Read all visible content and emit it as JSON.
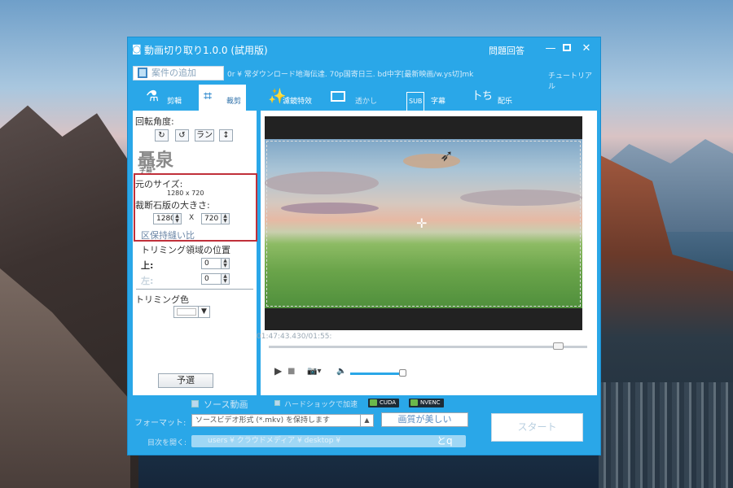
{
  "window": {
    "title": "動画切り取り1.0.0 (試用版)",
    "help": "問題回答",
    "minimize": "—",
    "close": "✕"
  },
  "filebar": {
    "add_label": "案件の追加",
    "file_path": "0r ¥ 常ダウンロード地海伝達. 70p国寄日三. bd中字[最新映画/w.ys切]mk",
    "tutorial": "チュートリアル"
  },
  "tabs": [
    {
      "label": "剪輯",
      "icon": "⚗"
    },
    {
      "label": "裁剪",
      "icon": "⌗"
    },
    {
      "label": "濾鏡特效",
      "icon": "✨"
    },
    {
      "label": "透かし",
      "icon": "▭"
    },
    {
      "label": "字幕",
      "icon": "SUB"
    },
    {
      "label": "配乐",
      "icon": "卜ち"
    }
  ],
  "left": {
    "rotation_label": "回転角度:",
    "rot_buttons": [
      "↻",
      "↺",
      "ラン",
      "↕"
    ],
    "logo_text": "聶泉",
    "logo_sub": "字幕*",
    "orig_size_label": "元のサイズ:",
    "orig_size_value": "1280 x 720",
    "crop_size_label": "裁断石版の大きさ:",
    "crop_width": "1280",
    "crop_height": "720",
    "times": "X",
    "keep_ratio": "区保持縫い比",
    "trim_pos_label": "トリミング領域の位置",
    "top_label": "上:",
    "top_value": "0",
    "left_label": "左:",
    "left_value": "0",
    "trim_color_label": "トリミング色",
    "preset_label": "予選"
  },
  "player": {
    "time": "01:47:43.430/01:55:",
    "play": "▶",
    "stop": "■",
    "camera": "📷▾",
    "volume": "🔈",
    "seek_position_pct": 93,
    "volume_pct": 95
  },
  "bottom": {
    "source_video": "ソース動画",
    "hw_accel": "ハードショックで加速",
    "cuda": "CUDA",
    "nvenc": "NVENC",
    "format_label": "フォーマット:",
    "format_value": "ソースビデオ形式 (*.mkv) を保持します",
    "quality_btn": "画質が美しい",
    "start_btn": "スタート",
    "output_label": "目次を開く:",
    "output_path": "users ¥ クラウドメディア ¥ desktop ¥",
    "output_open": "とq"
  },
  "colors": {
    "window_bg": "#2aa7e8",
    "highlight_box": "#c0303a",
    "active_tab_text": "#2a6ea8"
  }
}
